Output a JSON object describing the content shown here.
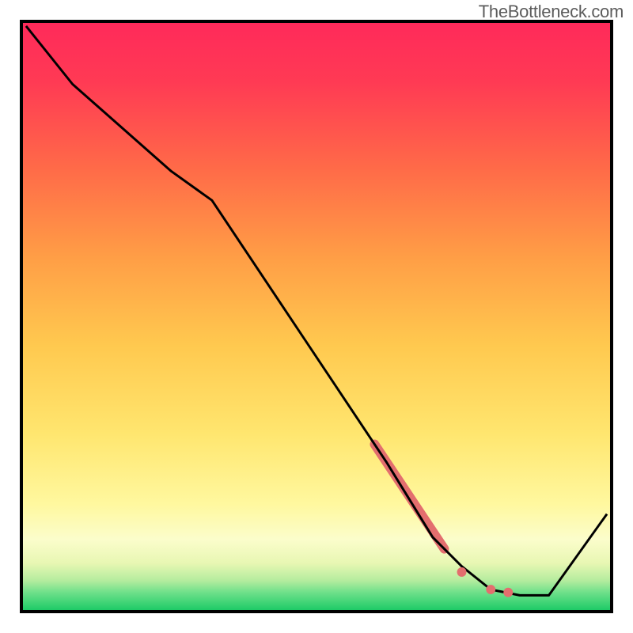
{
  "watermark": "TheBottleneck.com",
  "chart_data": {
    "type": "line",
    "title": "",
    "xlabel": "",
    "ylabel": "",
    "xlim": [
      0,
      100
    ],
    "ylim": [
      0,
      100
    ],
    "grid": false,
    "series": [
      {
        "name": "bottleneck-curve",
        "x": [
          0,
          8,
          25,
          32,
          62,
          70,
          75,
          80,
          85,
          90,
          100
        ],
        "y": [
          100,
          90,
          75,
          70,
          25,
          12,
          7,
          3,
          2,
          2,
          16
        ]
      }
    ],
    "markers": [
      {
        "name": "highlight-segment-thick",
        "type": "line",
        "x": [
          60,
          72
        ],
        "y": [
          28,
          10
        ],
        "stroke": "#e36e6e",
        "width": 12
      },
      {
        "name": "marker-dot-1",
        "type": "point",
        "x": 75,
        "y": 6,
        "r": 6,
        "fill": "#e36e6e"
      },
      {
        "name": "marker-dot-2",
        "type": "point",
        "x": 80,
        "y": 3,
        "r": 6,
        "fill": "#e36e6e"
      },
      {
        "name": "marker-dot-3",
        "type": "point",
        "x": 83,
        "y": 2.5,
        "r": 6,
        "fill": "#e36e6e"
      }
    ],
    "colors": {
      "line": "#000000",
      "highlight": "#e36e6e",
      "gradient_top": "#ff2a5a",
      "gradient_bottom": "#1ecb67"
    }
  }
}
